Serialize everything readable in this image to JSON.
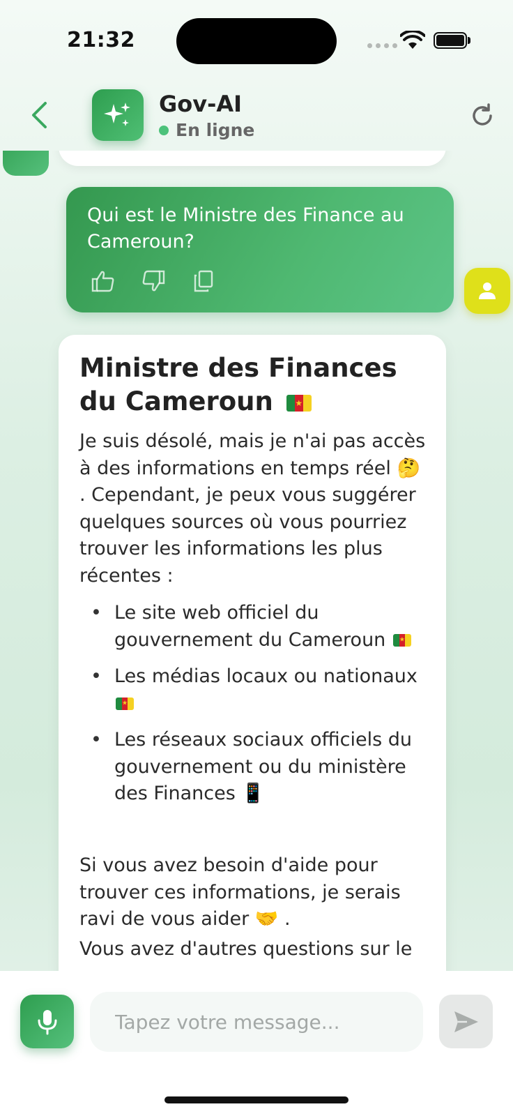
{
  "status_bar": {
    "time": "21:32"
  },
  "header": {
    "title": "Gov-AI",
    "status": "En ligne",
    "accent_color": "#3aa85f",
    "online_color": "#4cc27a"
  },
  "chat": {
    "user_message": {
      "text": "Qui est le Ministre des Finance au Cameroun?",
      "actions": [
        "thumbs-up-icon",
        "thumbs-down-icon",
        "copy-icon"
      ]
    },
    "bot_message": {
      "title": "Ministre des Finances du Cameroun",
      "intro_before_emoji": "Je suis désolé, mais je n'ai pas accès à des informations en temps réel",
      "intro_emoji": "🤔",
      "intro_after_emoji": ". Cependant, je peux vous suggérer quelques sources où vous pourriez trouver les informations les plus récentes :",
      "list": [
        {
          "text": "Le site web officiel du gouvernement du Cameroun",
          "emoji": "flag-cameroon"
        },
        {
          "text": "Les médias locaux ou nationaux",
          "emoji": "flag-cameroon"
        },
        {
          "text": "Les réseaux sociaux officiels du gouvernement ou du ministère des Finances",
          "emoji": "📱"
        }
      ],
      "closing_before_emoji": "Si vous avez besoin d'aide pour trouver ces informations, je serais ravi de vous aider",
      "closing_emoji": "🤝",
      "closing_after_emoji": ".",
      "follow_up": "Vous avez d'autres questions sur le"
    }
  },
  "input": {
    "placeholder": "Tapez votre message..."
  }
}
